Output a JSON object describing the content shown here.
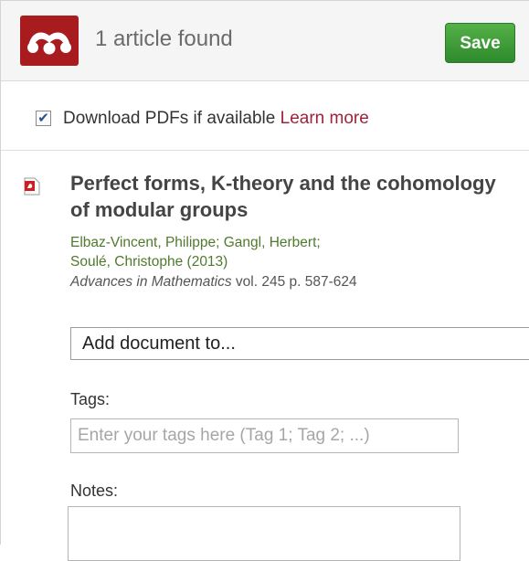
{
  "header": {
    "logo_icon": "mendeley-logo-icon",
    "logo_color": "#a81c1f",
    "title": "1 article found",
    "save_label": "Save",
    "save_color": "#3c9b36"
  },
  "options": {
    "download_pdfs_checked": true,
    "download_pdfs_label": "Download PDFs if available",
    "learn_more_label": "Learn more"
  },
  "article": {
    "icon": "pdf-icon",
    "title": "Perfect forms, K-theory and the cohomology of modular groups",
    "authors_line1": "Elbaz-Vincent, Philippe;  Gangl, Herbert;",
    "authors_line2": "Soulé, Christophe",
    "year": "(2013)",
    "journal": "Advances in Mathematics",
    "volume_pages": "vol. 245 p. 587-624"
  },
  "form": {
    "add_document_label": "Add document to...",
    "tags_label": "Tags:",
    "tags_placeholder": "Enter your tags here (Tag 1; Tag 2; ...)",
    "tags_value": "",
    "notes_label": "Notes:",
    "notes_value": ""
  }
}
